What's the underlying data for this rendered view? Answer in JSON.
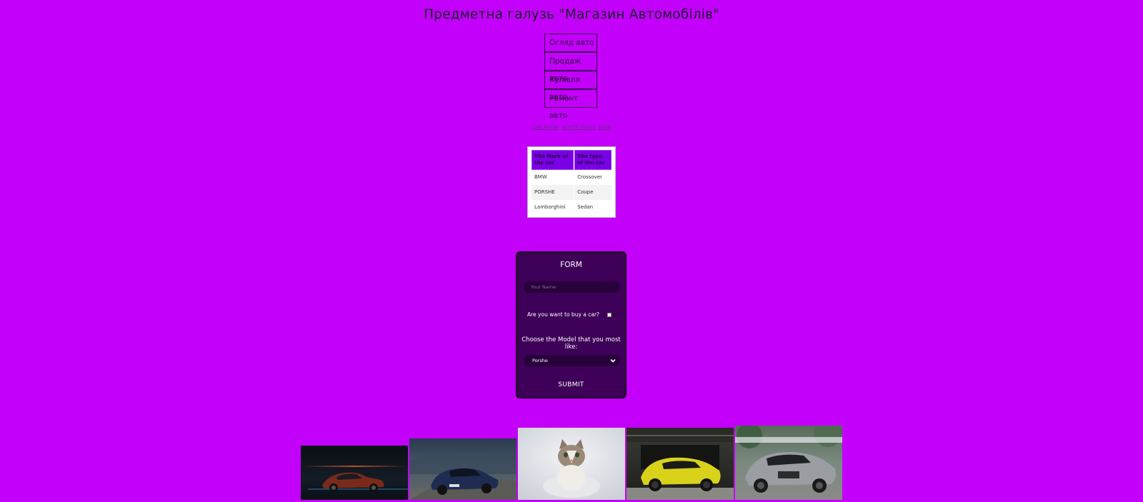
{
  "page": {
    "title": "Предметна галузь \"Магазин Автомобілів\""
  },
  "nav": {
    "items": [
      {
        "label": "Огляд авто"
      },
      {
        "label": "Продаж авто"
      },
      {
        "label": "Купівля авто"
      },
      {
        "label": "Ремонт авто"
      }
    ]
  },
  "links": [
    "Link to the",
    "search above",
    "table"
  ],
  "table": {
    "headers": [
      "The Mark of the car",
      "The type of the car"
    ],
    "rows": [
      [
        "BMW",
        "Crossover"
      ],
      [
        "PORSHE",
        "Coupe"
      ],
      [
        "Lamborghini",
        "Sedan"
      ]
    ]
  },
  "form": {
    "title": "FORM",
    "name_placeholder": "Your Name",
    "question": "Are you want to buy a car?",
    "choose_label": "Choose the Model that you most like:",
    "model_selected": "Porshe",
    "submit_label": "SUBMIT"
  },
  "gallery": [
    {
      "name": "porsche-photo"
    },
    {
      "name": "bmw-photo"
    },
    {
      "name": "cat-photo"
    },
    {
      "name": "lamborghini-photo"
    },
    {
      "name": "mercedes-photo"
    }
  ],
  "colors": {
    "background": "#c300fa",
    "form_bg": "#3e0058",
    "table_header": "#7a00e6"
  }
}
